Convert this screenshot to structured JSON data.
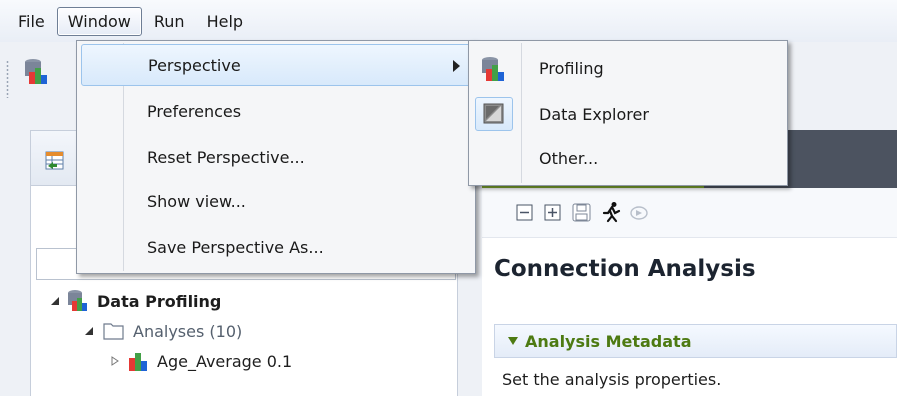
{
  "menubar": {
    "items": [
      {
        "label": "File"
      },
      {
        "label": "Window"
      },
      {
        "label": "Run"
      },
      {
        "label": "Help"
      }
    ]
  },
  "window_menu": {
    "items": [
      {
        "label": "Perspective",
        "has_submenu": true,
        "highlighted": true
      },
      {
        "label": "Preferences"
      },
      {
        "label": "Reset Perspective..."
      },
      {
        "label": "Show view..."
      },
      {
        "label": "Save Perspective As..."
      }
    ]
  },
  "perspective_submenu": {
    "items": [
      {
        "label": "Profiling",
        "icon": "profiling-icon"
      },
      {
        "label": "Data Explorer",
        "icon": "data-explorer-icon",
        "checked": true
      },
      {
        "label": "Other..."
      }
    ]
  },
  "tree": {
    "root": {
      "label": "Data Profiling"
    },
    "analyses": {
      "label": "Analyses (10)"
    },
    "first_item": {
      "label": "Age_Average 0.1"
    }
  },
  "editor": {
    "title": "Connection Analysis",
    "section_title": "Analysis Metadata",
    "section_description": "Set the analysis properties."
  },
  "colors": {
    "accent_green": "#7ea52e",
    "section_title_green": "#4d7a12",
    "menu_highlight": "#d8e9fb",
    "editor_tabbar": "#4c5360"
  }
}
